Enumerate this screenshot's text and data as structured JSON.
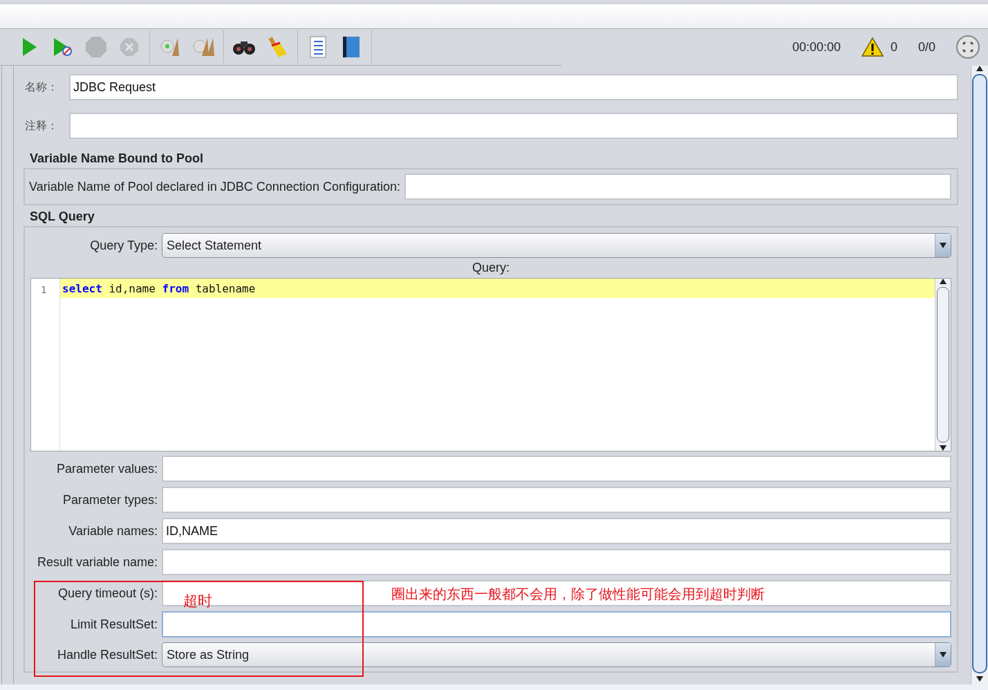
{
  "toolbar": {
    "buttons": [
      {
        "kind": "start",
        "disabled": false
      },
      {
        "kind": "start-no-pause",
        "disabled": false
      },
      {
        "kind": "stop",
        "disabled": true
      },
      {
        "kind": "shutdown",
        "disabled": true
      },
      {
        "kind": "clear",
        "disabled": false
      },
      {
        "kind": "clear-all",
        "disabled": false
      },
      {
        "kind": "search",
        "disabled": false
      },
      {
        "kind": "reset-search",
        "disabled": false
      },
      {
        "kind": "function",
        "disabled": false
      },
      {
        "kind": "help",
        "disabled": false
      }
    ],
    "timer": "00:00:00",
    "warnings": "0",
    "threads": "0/0"
  },
  "name": {
    "label": "名称：",
    "value": "JDBC Request"
  },
  "comment": {
    "label": "注释："
  },
  "pool_section": {
    "title": "Variable Name Bound to Pool",
    "label": "Variable Name of Pool declared in JDBC Connection Configuration:"
  },
  "sql_section": {
    "title": "SQL Query",
    "query_type_label": "Query Type:",
    "query_type": "Select Statement",
    "query_label": "Query:",
    "editor": {
      "line_number": "1",
      "tokens": [
        {
          "text": "select",
          "kind": "keyword"
        },
        {
          "text": " id,name ",
          "kind": "plain"
        },
        {
          "text": "from",
          "kind": "keyword"
        },
        {
          "text": " tablename",
          "kind": "plain"
        }
      ]
    },
    "fields": [
      {
        "label": "Parameter values:",
        "kind": "text",
        "focused": false
      },
      {
        "label": "Parameter types:",
        "kind": "text",
        "focused": false
      },
      {
        "label": "Variable names:",
        "kind": "text",
        "value": "ID,NAME",
        "focused": false
      },
      {
        "label": "Result variable name:",
        "kind": "text",
        "focused": false
      },
      {
        "label": "Query timeout (s):",
        "kind": "text",
        "focused": false
      },
      {
        "label": "Limit ResultSet:",
        "kind": "text",
        "focused": true
      },
      {
        "label": "Handle ResultSet:",
        "kind": "select",
        "value": "Store as String",
        "focused": false
      }
    ]
  },
  "annotations": {
    "box_note": "超时",
    "note": "圈出来的东西一般都不会用，除了做性能可能会用到超时判断"
  }
}
